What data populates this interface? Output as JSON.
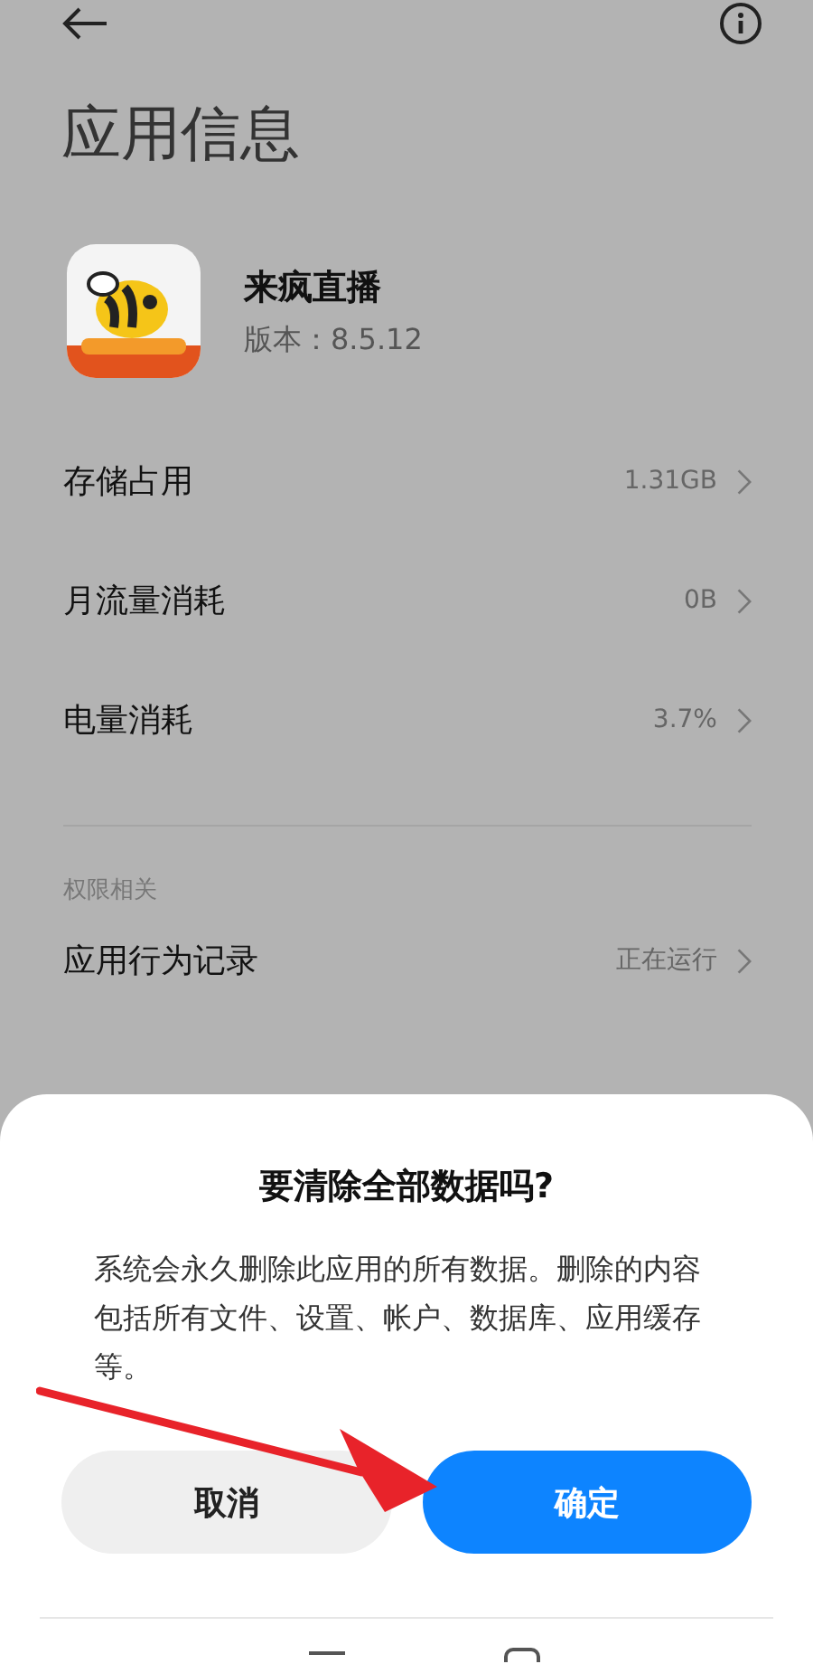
{
  "page": {
    "title": "应用信息"
  },
  "app": {
    "name": "来疯直播",
    "version": "版本：8.5.12"
  },
  "rows": [
    {
      "label": "存储占用",
      "value": "1.31GB"
    },
    {
      "label": "月流量消耗",
      "value": "0B"
    },
    {
      "label": "电量消耗",
      "value": "3.7%"
    }
  ],
  "section": {
    "title": "权限相关",
    "rows": [
      {
        "label": "应用行为记录",
        "value": "正在运行"
      }
    ]
  },
  "dialog": {
    "title": "要清除全部数据吗?",
    "message": "系统会永久删除此应用的所有数据。删除的内容包括所有文件、设置、帐户、数据库、应用缓存等。",
    "buttons": [
      {
        "label": "取消",
        "kind": "secondary"
      },
      {
        "label": "确定",
        "kind": "primary"
      }
    ]
  }
}
